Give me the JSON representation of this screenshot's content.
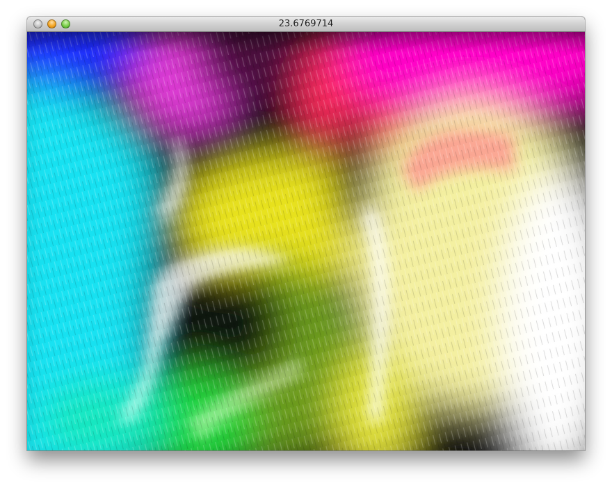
{
  "window": {
    "title": "23.6769714",
    "controls": {
      "close": "close-icon",
      "minimize": "minimize-icon",
      "zoom": "zoom-icon"
    }
  },
  "canvas": {
    "content": "particle-flow-field-render",
    "palette": [
      "#00e6ff",
      "#18d6ff",
      "#1a2dff",
      "#ff33e0",
      "#ff1f5a",
      "#ff00ff",
      "#ffff3a",
      "#44ff22",
      "#ffffff"
    ]
  }
}
